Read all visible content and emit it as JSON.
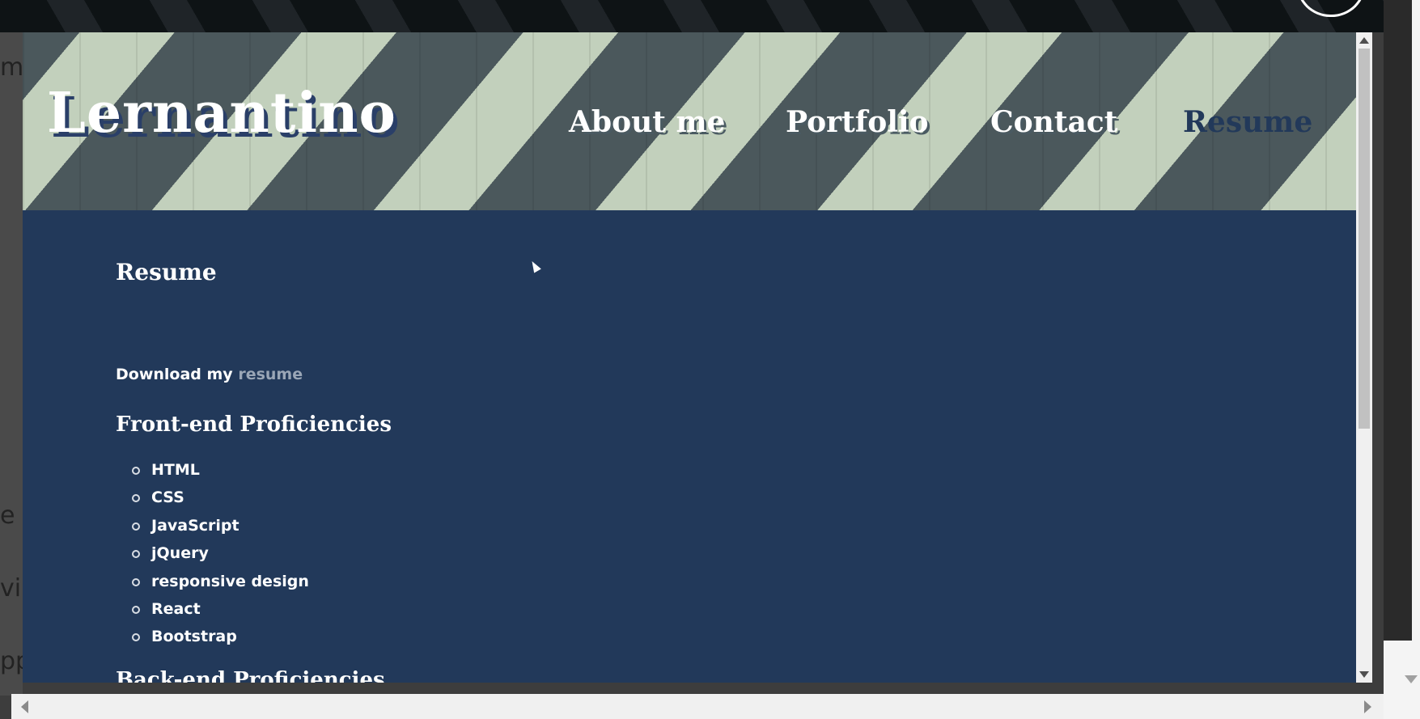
{
  "background_page": {
    "left_fragments": [
      "me",
      "e",
      "vi",
      "pp"
    ]
  },
  "modal": {
    "logo": "Lernantino",
    "nav": [
      "About me",
      "Portfolio",
      "Contact",
      "Resume"
    ],
    "active_nav": "Resume",
    "resume_title": "Resume",
    "download_prefix": "Download my",
    "download_link": "resume",
    "frontend_heading": "Front-end Proficiencies",
    "frontend_items": [
      "HTML",
      "CSS",
      "JavaScript",
      "jQuery",
      "responsive design",
      "React",
      "Bootstrap"
    ],
    "backend_heading": "Back-end Proficiencies"
  },
  "colors": {
    "content_bg": "#22395a",
    "stripe_light": "#c2d0bc",
    "stripe_dark": "#4b585c",
    "link_muted": "#9aa6b6"
  }
}
